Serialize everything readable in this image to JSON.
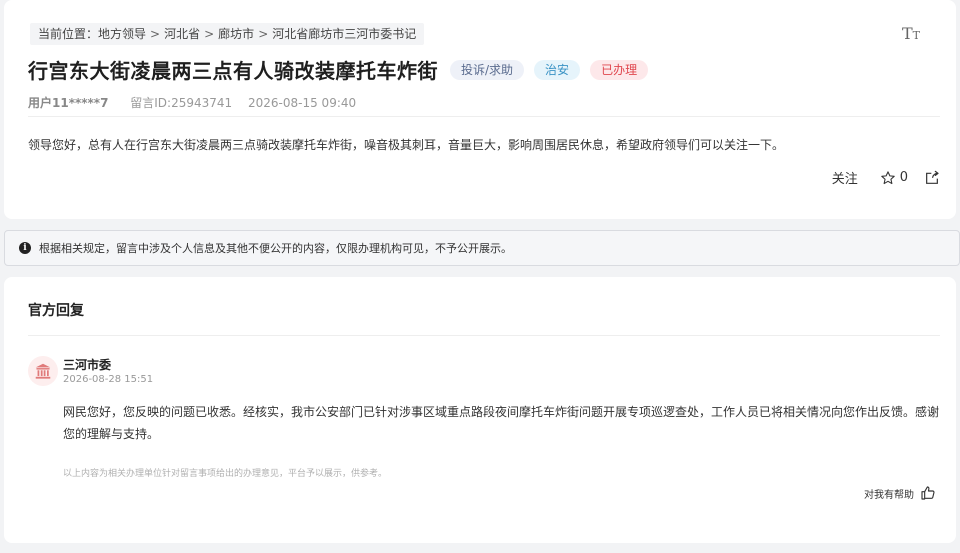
{
  "breadcrumb": {
    "prefix": "当前位置：",
    "items": [
      "地方领导",
      "河北省",
      "廊坊市",
      "河北省廊坊市三河市委书记"
    ],
    "separator": ">"
  },
  "font_size_toggle": {
    "big": "T",
    "small": "T"
  },
  "message": {
    "title": "行宫东大街凌晨两三点有人骑改装摩托车炸街",
    "tags": {
      "type": "投诉/求助",
      "category": "治安",
      "status": "已办理"
    },
    "user": "用户11*****7",
    "message_id": "留言ID:25943741",
    "datetime": "2026-08-15 09:40",
    "content": "领导您好，总有人在行宫东大街凌晨两三点骑改装摩托车炸街，噪音极其刺耳，音量巨大，影响周围居民休息，希望政府领导们可以关注一下。"
  },
  "actions": {
    "follow_label": "关注",
    "favorite_count": "0"
  },
  "notice": {
    "icon": "i",
    "text": "根据相关规定，留言中涉及个人信息及其他不便公开的内容，仅限办理机构可见，不予公开展示。"
  },
  "reply": {
    "section_title": "官方回复",
    "org": "三河市委",
    "time": "2026-08-28 15:51",
    "content": "网民您好，您反映的问题已收悉。经核实，我市公安部门已针对涉事区域重点路段夜间摩托车炸街问题开展专项巡逻查处，工作人员已将相关情况向您作出反馈。感谢您的理解与支持。",
    "disclaimer": "以上内容为相关办理单位针对留言事项给出的办理意见，平台予以展示，供参考。",
    "helpful_label": "对我有帮助"
  },
  "colors": {
    "status_red": "#e0474f",
    "category_blue": "#3a93c5",
    "type_gray": "#5a6b8e",
    "avatar_red": "#e07a7a"
  },
  "icons": {
    "font_size": "font-size-icon",
    "star": "star-icon",
    "share": "share-icon",
    "info": "info-icon",
    "avatar": "government-building-icon",
    "thumb": "thumbs-up-icon"
  }
}
